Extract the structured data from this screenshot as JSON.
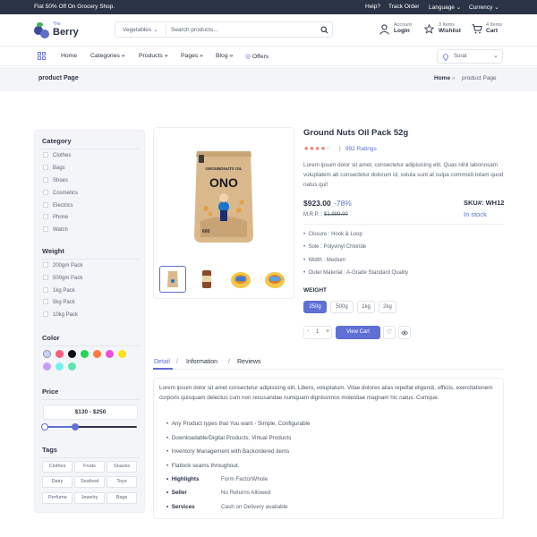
{
  "topbar": {
    "promo": "Flat 50% Off On Grocery Shop.",
    "help": "Help?",
    "track": "Track Order",
    "language": "Language",
    "currency": "Currency"
  },
  "header": {
    "logo_small": "The",
    "logo_big": "Berry",
    "search_category": "Vegetables",
    "search_placeholder": "Search products...",
    "account_small": "Account",
    "account_big": "Login",
    "wishlist_small": "3 Items",
    "wishlist_big": "Wishlist",
    "cart_small": "4 Items",
    "cart_big": "Cart"
  },
  "nav": {
    "items": [
      "Home",
      "Categories",
      "Products",
      "Pages",
      "Blog",
      "Offers"
    ],
    "location": "Surat"
  },
  "breadcrumb": {
    "page_title": "product Page",
    "home": "Home",
    "sep": "»",
    "current": "product Page"
  },
  "sidebar": {
    "category_title": "Category",
    "categories": [
      "Clothes",
      "Bags",
      "Shoes",
      "Cosmetics",
      "Electrics",
      "Phone",
      "Watch"
    ],
    "weight_title": "Weight",
    "weights": [
      "200gm Pack",
      "500gm Pack",
      "1kg Pack",
      "5kg Pack",
      "10kg Pack"
    ],
    "color_title": "Color",
    "colors": [
      "#c9d4ff",
      "#ff5c7a",
      "#111111",
      "#22d454",
      "#ff7a3d",
      "#e94fd9",
      "#ffe11a",
      "#c69cf7",
      "#72f2ef",
      "#57e8b0"
    ],
    "price_title": "Price",
    "price_range": "$130 - $250",
    "tags_title": "Tags",
    "tags": [
      "Clothes",
      "Fruits",
      "Snacks",
      "Dairy",
      "Seafood",
      "Toys",
      "Perfume",
      "Jewelry",
      "Bags"
    ]
  },
  "product": {
    "title": "Ground Nuts Oil Pack 52g",
    "rating": 4,
    "ratings_text": "992 Ratings",
    "rating_sep": "|",
    "description": "Lorem ipsum dolor sit amet, consectetur adipisicing elit. Quas nihil laboriosam voluptatem ab consectetur dolorum id, soluta sunt at culpa commodi totam quod natus qui!",
    "price": "$923.00",
    "discount": "-78%",
    "mrp_label": "M.R.P. :",
    "mrp": "$1,999.00",
    "sku": "SKU#: WH12",
    "stock": "In stock",
    "features": [
      "Closure : Hook & Loop",
      "Sole : Polyvinyl Chloride",
      "Width : Medium",
      "Outer Material : A-Grade Standard Quality"
    ],
    "weight_label": "WEIGHT",
    "sizes": [
      "250g",
      "500g",
      "1kg",
      "2kg"
    ],
    "qty": "1",
    "minus": "-",
    "plus": "+",
    "cart_button": "View Cart",
    "pack_brand": "GROUNDNUTS OIL",
    "pack_name": "ONO",
    "pack_weight": "600"
  },
  "tabs": {
    "items": [
      "Detail",
      "Information",
      "Reviews"
    ],
    "sep": "/"
  },
  "detail": {
    "text": "Lorem ipsum dolor sit amet consectetur adipisicing elit. Libero, voluptatum. Vitae dolores alias repellat eligendi, officiis, exercitationem corporis quisquam delectus cum non recusandae numquam dignissimos molestiae magnam hic natus. Cumque.",
    "bullets": [
      "Any Product types that You want - Simple, Configurable",
      "Downloadable/Digital Products, Virtual Products",
      "Inventory Management with Backordered items",
      "Flatlock seams throughout."
    ],
    "specs": [
      {
        "key": "Highlights",
        "value": "Form FactorWhole"
      },
      {
        "key": "Seller",
        "value": "No Returns Allowed"
      },
      {
        "key": "Services",
        "value": "Cash on Delivery available"
      }
    ]
  },
  "theme": {
    "accent": "#5f6fd4",
    "dark": "#2b3447",
    "text": "#5b6576"
  }
}
